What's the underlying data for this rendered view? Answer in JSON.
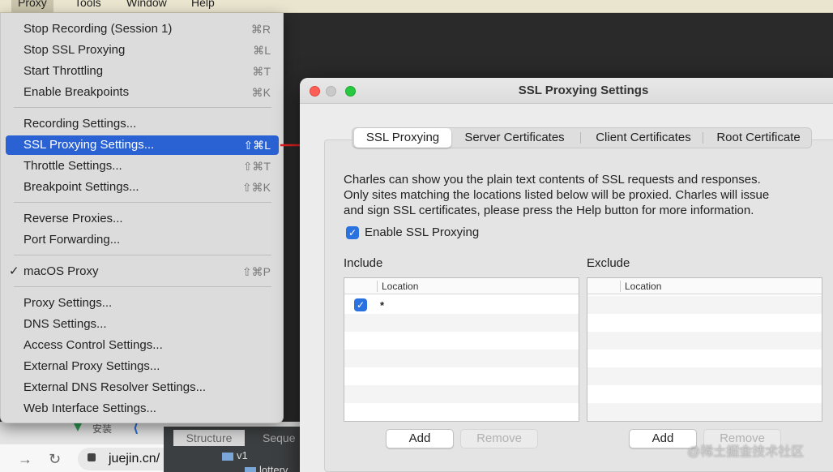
{
  "menubar": {
    "items": [
      "Proxy",
      "Tools",
      "Window",
      "Help"
    ]
  },
  "proxy_menu": {
    "items": [
      {
        "label": "Stop Recording (Session 1)",
        "shortcut": "⌘R"
      },
      {
        "label": "Stop SSL Proxying",
        "shortcut": "⌘L"
      },
      {
        "label": "Start Throttling",
        "shortcut": "⌘T"
      },
      {
        "label": "Enable Breakpoints",
        "shortcut": "⌘K"
      },
      {
        "label": "Recording Settings...",
        "shortcut": ""
      },
      {
        "label": "SSL Proxying Settings...",
        "shortcut": "⇧⌘L"
      },
      {
        "label": "Throttle Settings...",
        "shortcut": "⇧⌘T"
      },
      {
        "label": "Breakpoint Settings...",
        "shortcut": "⇧⌘K"
      },
      {
        "label": "Reverse Proxies...",
        "shortcut": ""
      },
      {
        "label": "Port Forwarding...",
        "shortcut": ""
      },
      {
        "label": "macOS Proxy",
        "shortcut": "⇧⌘P",
        "checked": true,
        "check_mark": "✓"
      },
      {
        "label": "Proxy Settings...",
        "shortcut": ""
      },
      {
        "label": "DNS Settings...",
        "shortcut": ""
      },
      {
        "label": "Access Control Settings...",
        "shortcut": ""
      },
      {
        "label": "External Proxy Settings...",
        "shortcut": ""
      },
      {
        "label": "External DNS Resolver Settings...",
        "shortcut": ""
      },
      {
        "label": "Web Interface Settings...",
        "shortcut": ""
      }
    ],
    "selected": "SSL Proxying Settings..."
  },
  "dialog": {
    "title": "SSL Proxying Settings",
    "tabs": [
      "SSL Proxying",
      "Server Certificates",
      "Client Certificates",
      "Root Certificate"
    ],
    "active_tab": "SSL Proxying",
    "description_lines": [
      "Charles can show you the plain text contents of SSL requests and responses.",
      "Only sites matching the locations listed below will be proxied. Charles will issue",
      "and sign SSL certificates, please press the Help button for more information."
    ],
    "enable_checkbox": {
      "label": "Enable SSL Proxying",
      "checked": true,
      "mark": "✓"
    },
    "include": {
      "label": "Include",
      "column": "Location",
      "rows": [
        {
          "checked": true,
          "mark": "✓",
          "location": "*"
        }
      ],
      "add_label": "Add",
      "remove_label": "Remove"
    },
    "exclude": {
      "label": "Exclude",
      "column": "Location",
      "rows": [],
      "add_label": "Add",
      "remove_label": "Remove"
    }
  },
  "background": {
    "browser": {
      "url": "juejin.cn/",
      "back": "←",
      "forward": "→",
      "reload": "↻"
    },
    "ide": {
      "tab_structure": "Structure",
      "tab_sequence": "Seque",
      "tree_item_1": "v1",
      "tree_item_2": "lottery"
    },
    "install_label": "安装",
    "k_glyph": "⟨"
  },
  "watermark": "@稀土掘金技术社区",
  "accent": "#2a62d4",
  "arrow_color": "#e02020"
}
